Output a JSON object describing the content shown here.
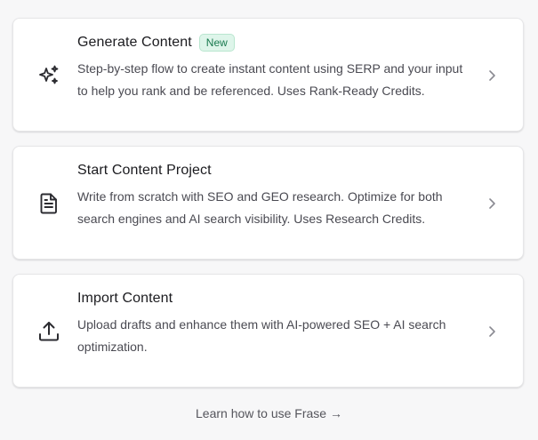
{
  "cards": [
    {
      "title": "Generate Content",
      "badge": "New",
      "description": "Step-by-step flow to create instant content using SERP and your input to help you rank and be referenced. Uses Rank-Ready Credits.",
      "icon": "sparkles-icon"
    },
    {
      "title": "Start Content Project",
      "description": "Write from scratch with SEO and GEO research. Optimize for both search engines and AI search visibility. Uses Research Credits.",
      "icon": "document-icon"
    },
    {
      "title": "Import Content",
      "description": "Upload drafts and enhance them with AI-powered SEO + AI search optimization.",
      "icon": "upload-icon"
    }
  ],
  "footer": {
    "link_label": "Learn how to use Frase →"
  },
  "colors": {
    "badge_bg": "#def5ea",
    "badge_text": "#18794e",
    "card_bg": "#ffffff",
    "page_bg": "#f7f7f8"
  }
}
